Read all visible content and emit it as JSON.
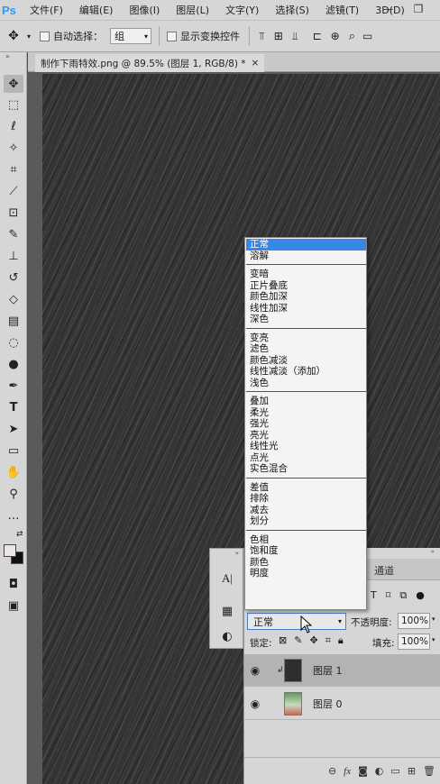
{
  "menubar": {
    "app_logo": "Ps",
    "items": [
      "文件(F)",
      "编辑(E)",
      "图像(I)",
      "图层(L)",
      "文字(Y)",
      "选择(S)",
      "滤镜(T)",
      "3D(D)"
    ],
    "minimize": "—",
    "restore": "❐"
  },
  "options": {
    "auto_select_label": "自动选择：",
    "auto_select_value": "组",
    "show_transform_label": "显示变换控件"
  },
  "document": {
    "tab_title": "制作下雨特效.png @ 89.5% (图层 1, RGB/8) *",
    "close": "×"
  },
  "blend_menu": {
    "groups": [
      [
        "正常",
        "溶解"
      ],
      [
        "变暗",
        "正片叠底",
        "颜色加深",
        "线性加深",
        "深色"
      ],
      [
        "变亮",
        "滤色",
        "颜色减淡",
        "线性减淡（添加）",
        "浅色"
      ],
      [
        "叠加",
        "柔光",
        "强光",
        "亮光",
        "线性光",
        "点光",
        "实色混合"
      ],
      [
        "差值",
        "排除",
        "减去",
        "划分"
      ],
      [
        "色相",
        "饱和度",
        "颜色",
        "明度"
      ]
    ],
    "selected": "正常"
  },
  "layers_panel": {
    "tab_channels": "通道",
    "blend_mode": "正常",
    "opacity_label": "不透明度:",
    "opacity_value": "100%",
    "lock_label": "锁定:",
    "fill_label": "填充:",
    "fill_value": "100%",
    "layers": [
      {
        "name": "图层 1",
        "selected": true
      },
      {
        "name": "图层 0",
        "selected": false
      }
    ]
  },
  "colors": {
    "ui_gray": "#d6d6d6",
    "canvas": "#343434",
    "highlight": "#3a86e6"
  }
}
